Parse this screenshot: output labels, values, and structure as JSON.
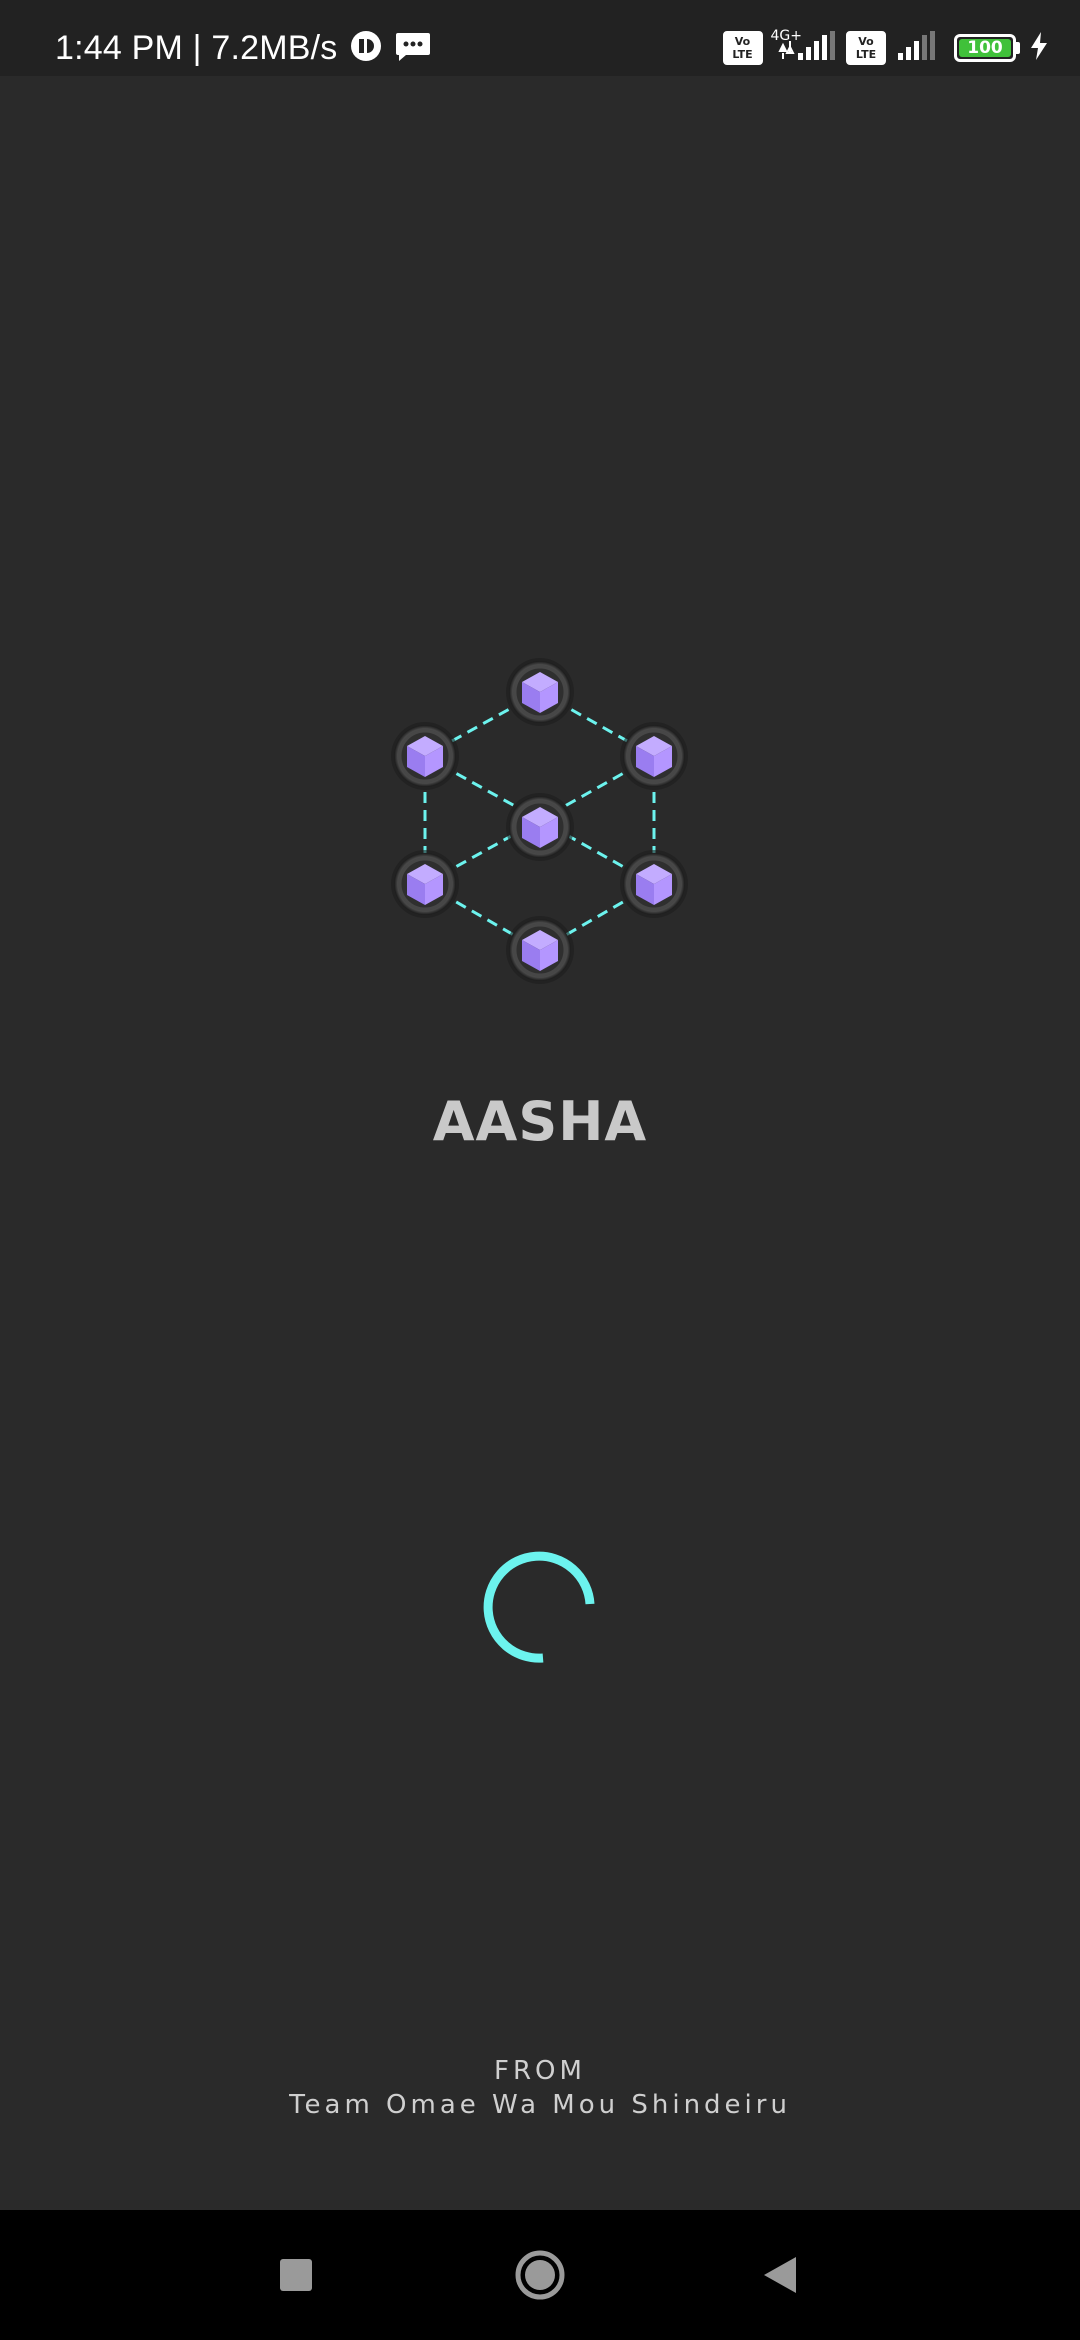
{
  "status_bar": {
    "time": "1:44 PM | 7.2MB/s",
    "volte_label_top": "Vo",
    "volte_label_bottom": "LTE",
    "network_type": "4G+",
    "battery_level": "100",
    "battery_fraction": 1.0,
    "icons": [
      "vpn-icon",
      "message-icon",
      "volte-icon",
      "signal-icon",
      "volte-icon",
      "signal-icon",
      "battery-icon",
      "charging-icon"
    ]
  },
  "splash": {
    "app_name": "AASHA",
    "logo_icon": "network-cube-logo-icon",
    "loading_icon": "loading-spinner-icon",
    "from_label": "FROM",
    "team_name": "Team Omae Wa Mou Shindeiru"
  },
  "colors": {
    "background": "#2a2a2a",
    "accent": "#6cf3ee",
    "cube": "#a98bff",
    "nav_background": "#000000"
  },
  "nav_bar": {
    "items": [
      "recent-apps-button",
      "home-button",
      "back-button"
    ]
  }
}
